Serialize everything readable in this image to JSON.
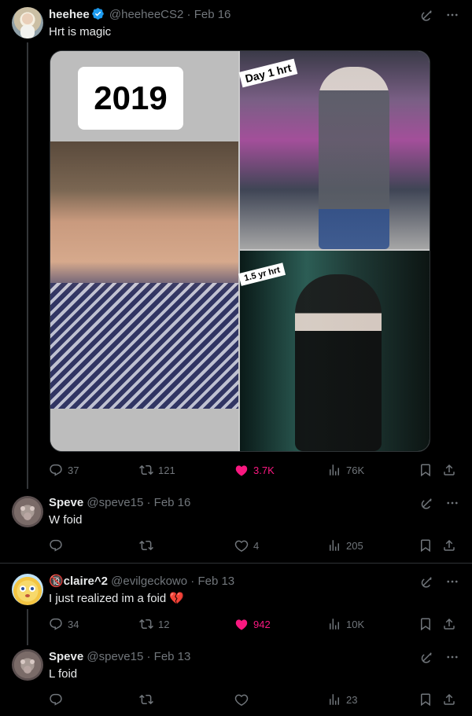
{
  "tweets": [
    {
      "name": "heehee",
      "handle": "@heeheeCS2",
      "date": "Feb 16",
      "text": "Hrt is magic",
      "verified": true,
      "media": {
        "year_label": "2019",
        "caption_top": "Day 1 hrt",
        "caption_bottom": "1.5 yr hrt"
      },
      "replies": "37",
      "reposts": "121",
      "likes": "3.7K",
      "liked": true,
      "views": "76K"
    },
    {
      "name": "Speve",
      "handle": "@speve15",
      "date": "Feb 16",
      "text": "W foid",
      "replies": "",
      "reposts": "",
      "likes": "4",
      "liked": false,
      "views": "205"
    },
    {
      "name": "🔞claire^2",
      "handle": "@evilgeckowo",
      "date": "Feb 13",
      "text": "I just realized im a foid 💔",
      "replies": "34",
      "reposts": "12",
      "likes": "942",
      "liked": true,
      "views": "10K"
    },
    {
      "name": "Speve",
      "handle": "@speve15",
      "date": "Feb 13",
      "text": "L foid",
      "replies": "",
      "reposts": "",
      "likes": "",
      "liked": false,
      "views": "23"
    }
  ],
  "separator": "·",
  "colors": {
    "background": "#000000",
    "text": "#e7e9ea",
    "muted": "#71767b",
    "like": "#f91880",
    "verified": "#1d9bf0"
  },
  "icons": [
    "verified-icon",
    "grok-icon",
    "more-icon",
    "reply-icon",
    "repost-icon",
    "like-icon",
    "views-icon",
    "bookmark-icon",
    "share-icon"
  ]
}
